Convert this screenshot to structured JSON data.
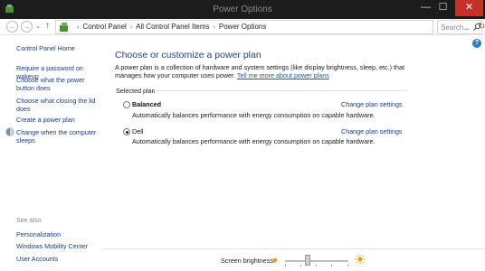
{
  "window": {
    "title": "Power Options",
    "minimize_glyph": "—",
    "maximize_glyph": "☐",
    "close_glyph": "✕"
  },
  "navbar": {
    "back_glyph": "←",
    "forward_glyph": "→",
    "dropdown_glyph": "⌄",
    "up_glyph": "↑",
    "breadcrumbs": [
      "Control Panel",
      "All Control Panel Items",
      "Power Options"
    ],
    "crumb_separator": "›",
    "refresh_glyph": "↻",
    "search_placeholder": "Search..."
  },
  "sidebar": {
    "home": "Control Panel Home",
    "links": [
      "Require a password on wakeup",
      "Choose what the power button does",
      "Choose what closing the lid does",
      "Create a power plan",
      "Change when the computer sleeps"
    ],
    "see_also_heading": "See also",
    "see_also": [
      "Personalization",
      "Windows Mobility Center",
      "User Accounts"
    ]
  },
  "main": {
    "title": "Choose or customize a power plan",
    "description": "A power plan is a collection of hardware and system settings (like display brightness, sleep, etc.) that manages how your computer uses power.",
    "tell_more_link": "Tell me more about power plans",
    "selected_plan_label": "Selected plan",
    "help_glyph": "?",
    "plans": [
      {
        "name": "Balanced",
        "selected": false,
        "description": "Automatically balances performance with energy consumption on capable hardware.",
        "settings_link": "Change plan settings"
      },
      {
        "name": "Dell",
        "selected": true,
        "description": "Automatically balances performance with energy consumption on capable hardware.",
        "settings_link": "Change plan settings"
      }
    ]
  },
  "bottom": {
    "brightness_label": "Screen brightness:",
    "brightness_level": 0.35
  },
  "colors": {
    "accent_link": "#1a3e8a",
    "title_blue": "#1e3f8f",
    "close_red": "#c7302a",
    "sun_orange": "#e8a21a"
  },
  "icons": {
    "app": "power-options-icon",
    "shield": "uac-shield-icon",
    "help": "help-icon",
    "search": "search-icon"
  }
}
